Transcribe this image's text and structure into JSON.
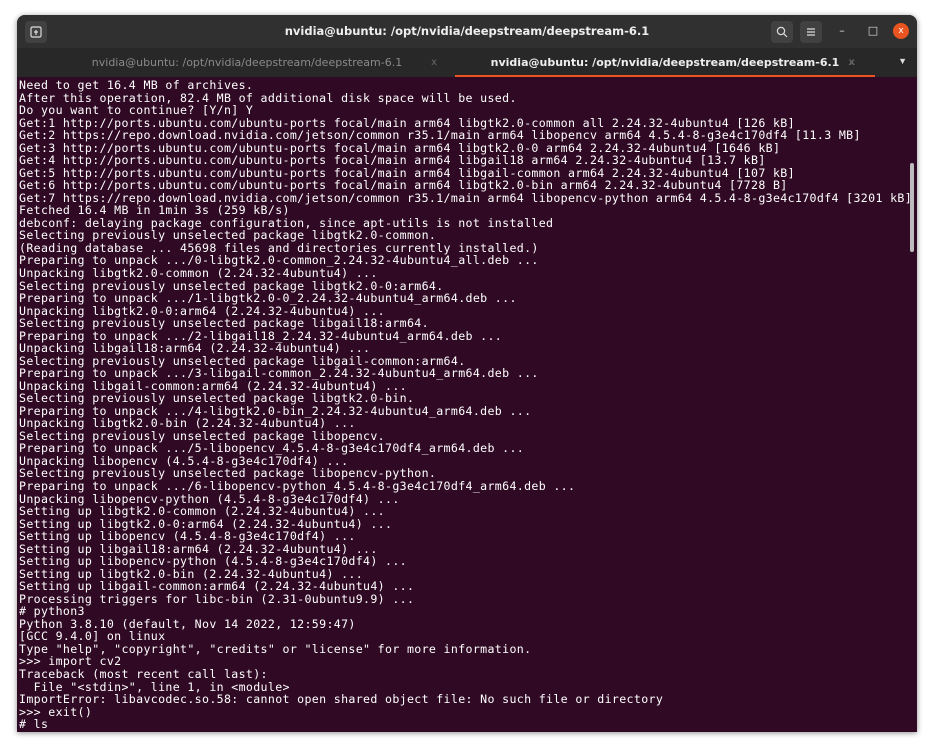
{
  "window": {
    "title": "nvidia@ubuntu: /opt/nvidia/deepstream/deepstream-6.1",
    "buttons": {
      "new_tab_icon": "terminal-tab-icon",
      "search_icon": "search-icon",
      "menu_icon": "hamburger-menu-icon",
      "minimize": "–",
      "maximize": "□",
      "close": "x"
    }
  },
  "tabs": [
    {
      "label": "nvidia@ubuntu: /opt/nvidia/deepstream/deepstream-6.1",
      "close": "x",
      "active": false
    },
    {
      "label": "nvidia@ubuntu: /opt/nvidia/deepstream/deepstream-6.1",
      "close": "x",
      "active": true
    }
  ],
  "tab_menu": "▼",
  "colors": {
    "terminal_bg": "#300a24",
    "accent": "#e95420",
    "text": "#ffffff"
  },
  "terminal_lines": [
    "Need to get 16.4 MB of archives.",
    "After this operation, 82.4 MB of additional disk space will be used.",
    "Do you want to continue? [Y/n] Y",
    "Get:1 http://ports.ubuntu.com/ubuntu-ports focal/main arm64 libgtk2.0-common all 2.24.32-4ubuntu4 [126 kB]",
    "Get:2 https://repo.download.nvidia.com/jetson/common r35.1/main arm64 libopencv arm64 4.5.4-8-g3e4c170df4 [11.3 MB]",
    "Get:3 http://ports.ubuntu.com/ubuntu-ports focal/main arm64 libgtk2.0-0 arm64 2.24.32-4ubuntu4 [1646 kB]",
    "Get:4 http://ports.ubuntu.com/ubuntu-ports focal/main arm64 libgail18 arm64 2.24.32-4ubuntu4 [13.7 kB]",
    "Get:5 http://ports.ubuntu.com/ubuntu-ports focal/main arm64 libgail-common arm64 2.24.32-4ubuntu4 [107 kB]",
    "Get:6 http://ports.ubuntu.com/ubuntu-ports focal/main arm64 libgtk2.0-bin arm64 2.24.32-4ubuntu4 [7728 B]",
    "Get:7 https://repo.download.nvidia.com/jetson/common r35.1/main arm64 libopencv-python arm64 4.5.4-8-g3e4c170df4 [3201 kB]",
    "Fetched 16.4 MB in 1min 3s (259 kB/s)",
    "debconf: delaying package configuration, since apt-utils is not installed",
    "Selecting previously unselected package libgtk2.0-common.",
    "(Reading database ... 45698 files and directories currently installed.)",
    "Preparing to unpack .../0-libgtk2.0-common_2.24.32-4ubuntu4_all.deb ...",
    "Unpacking libgtk2.0-common (2.24.32-4ubuntu4) ...",
    "Selecting previously unselected package libgtk2.0-0:arm64.",
    "Preparing to unpack .../1-libgtk2.0-0_2.24.32-4ubuntu4_arm64.deb ...",
    "Unpacking libgtk2.0-0:arm64 (2.24.32-4ubuntu4) ...",
    "Selecting previously unselected package libgail18:arm64.",
    "Preparing to unpack .../2-libgail18_2.24.32-4ubuntu4_arm64.deb ...",
    "Unpacking libgail18:arm64 (2.24.32-4ubuntu4) ...",
    "Selecting previously unselected package libgail-common:arm64.",
    "Preparing to unpack .../3-libgail-common_2.24.32-4ubuntu4_arm64.deb ...",
    "Unpacking libgail-common:arm64 (2.24.32-4ubuntu4) ...",
    "Selecting previously unselected package libgtk2.0-bin.",
    "Preparing to unpack .../4-libgtk2.0-bin_2.24.32-4ubuntu4_arm64.deb ...",
    "Unpacking libgtk2.0-bin (2.24.32-4ubuntu4) ...",
    "Selecting previously unselected package libopencv.",
    "Preparing to unpack .../5-libopencv_4.5.4-8-g3e4c170df4_arm64.deb ...",
    "Unpacking libopencv (4.5.4-8-g3e4c170df4) ...",
    "Selecting previously unselected package libopencv-python.",
    "Preparing to unpack .../6-libopencv-python_4.5.4-8-g3e4c170df4_arm64.deb ...",
    "Unpacking libopencv-python (4.5.4-8-g3e4c170df4) ...",
    "Setting up libgtk2.0-common (2.24.32-4ubuntu4) ...",
    "Setting up libgtk2.0-0:arm64 (2.24.32-4ubuntu4) ...",
    "Setting up libopencv (4.5.4-8-g3e4c170df4) ...",
    "Setting up libgail18:arm64 (2.24.32-4ubuntu4) ...",
    "Setting up libopencv-python (4.5.4-8-g3e4c170df4) ...",
    "Setting up libgtk2.0-bin (2.24.32-4ubuntu4) ...",
    "Setting up libgail-common:arm64 (2.24.32-4ubuntu4) ...",
    "Processing triggers for libc-bin (2.31-0ubuntu9.9) ...",
    "# python3",
    "Python 3.8.10 (default, Nov 14 2022, 12:59:47)",
    "[GCC 9.4.0] on linux",
    "Type \"help\", \"copyright\", \"credits\" or \"license\" for more information.",
    ">>> import cv2",
    "Traceback (most recent call last):",
    "  File \"<stdin>\", line 1, in <module>",
    "ImportError: libavcodec.so.58: cannot open shared object file: No such file or directory",
    ">>> exit()",
    "# ls"
  ]
}
